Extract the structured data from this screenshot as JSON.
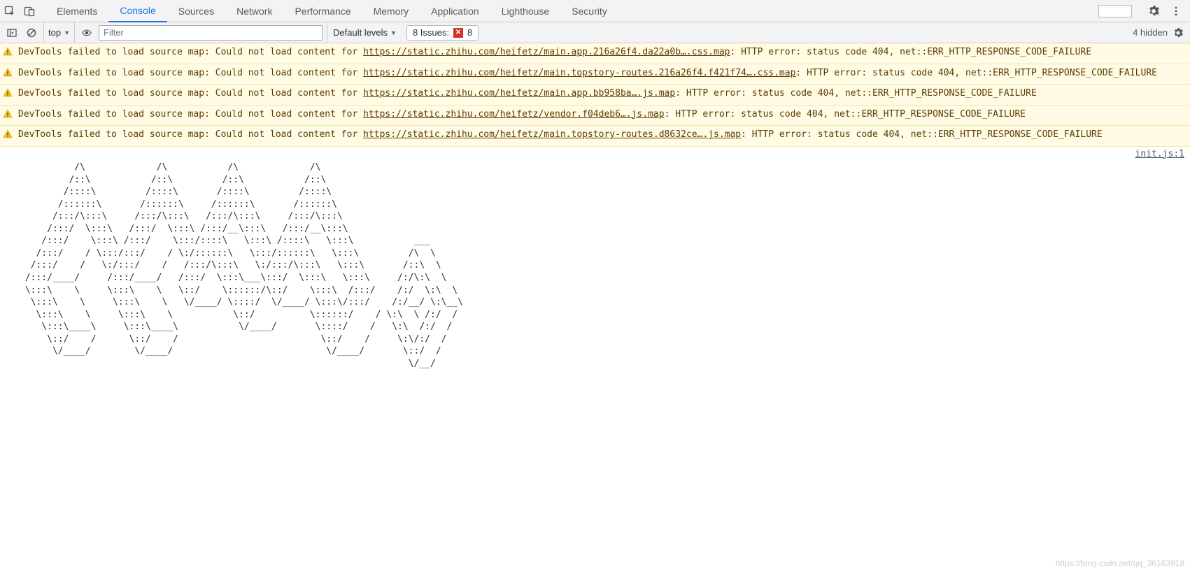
{
  "tabs": {
    "elements": "Elements",
    "console": "Console",
    "sources": "Sources",
    "network": "Network",
    "performance": "Performance",
    "memory": "Memory",
    "application": "Application",
    "lighthouse": "Lighthouse",
    "security": "Security"
  },
  "toolbar": {
    "context": "top",
    "filter_placeholder": "Filter",
    "levels": "Default levels",
    "issues_label": "8 Issues:",
    "issues_count": "8",
    "hidden": "4 hidden"
  },
  "warnings": [
    {
      "pre": "DevTools failed to load source map: Could not load content for ",
      "url": "https://static.zhihu.com/heifetz/main.app.216a26f4.da22a0b….css.map",
      "post": ": HTTP error: status code 404, net::ERR_HTTP_RESPONSE_CODE_FAILURE"
    },
    {
      "pre": "DevTools failed to load source map: Could not load content for ",
      "url": "https://static.zhihu.com/heifetz/main.topstory-routes.216a26f4.f421f74….css.map",
      "post": ": HTTP error: status code 404, net::ERR_HTTP_RESPONSE_CODE_FAILURE"
    },
    {
      "pre": "DevTools failed to load source map: Could not load content for ",
      "url": "https://static.zhihu.com/heifetz/main.app.bb958ba….js.map",
      "post": ": HTTP error: status code 404, net::ERR_HTTP_RESPONSE_CODE_FAILURE"
    },
    {
      "pre": "DevTools failed to load source map: Could not load content for ",
      "url": "https://static.zhihu.com/heifetz/vendor.f04deb6….js.map",
      "post": ": HTTP error: status code 404, net::ERR_HTTP_RESPONSE_CODE_FAILURE"
    },
    {
      "pre": "DevTools failed to load source map: Could not load content for ",
      "url": "https://static.zhihu.com/heifetz/main.topstory-routes.d8632ce….js.map",
      "post": ": HTTP error: status code 404, net::ERR_HTTP_RESPONSE_CODE_FAILURE"
    }
  ],
  "log": {
    "source": "init.js:1",
    "ascii": "          /\\             /\\           /\\             /\\\n         /::\\           /::\\         /::\\           /::\\\n        /::::\\         /::::\\       /::::\\         /::::\\\n       /::::::\\       /::::::\\     /::::::\\       /::::::\\\n      /:::/\\:::\\     /:::/\\:::\\   /:::/\\:::\\     /:::/\\:::\\\n     /:::/  \\:::\\   /:::/  \\:::\\ /:::/__\\:::\\   /:::/__\\:::\\\n    /:::/    \\:::\\ /:::/    \\:::/::::\\   \\:::\\ /::::\\   \\:::\\           ___\n   /:::/    / \\:::/:::/    / \\:/::::::\\   \\:::/::::::\\   \\:::\\         /\\  \\\n  /:::/    /   \\:/:::/    /   /:::/\\:::\\   \\:/:::/\\:::\\   \\:::\\       /::\\  \\\n /:::/____/     /:::/____/   /:::/  \\:::\\___\\:::/  \\:::\\   \\:::\\     /:/\\:\\  \\\n \\:::\\    \\     \\:::\\    \\   \\::/    \\::::::/\\::/    \\:::\\  /:::/    /:/  \\:\\  \\\n  \\:::\\    \\     \\:::\\    \\   \\/____/ \\::::/  \\/____/ \\:::\\/:::/    /:/__/ \\:\\__\\\n   \\:::\\    \\     \\:::\\    \\           \\::/          \\::::::/    / \\:\\  \\ /:/  /\n    \\:::\\____\\     \\:::\\____\\           \\/____/       \\::::/    /   \\:\\  /:/  /\n     \\::/    /      \\::/    /                          \\::/    /     \\:\\/:/  /\n      \\/____/        \\/____/                            \\/____/       \\::/  /\n                                                                       \\/__/"
  },
  "watermark": "https://blog.csdn.net/qq_36163918"
}
